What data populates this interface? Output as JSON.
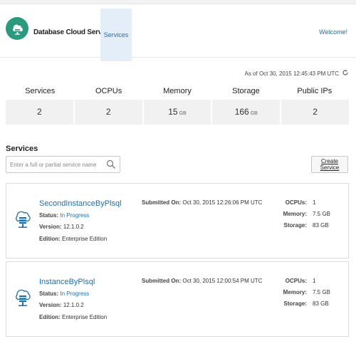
{
  "header": {
    "app_title": "Database Cloud Service",
    "nav_tab": "Services",
    "welcome": "Welcome!"
  },
  "as_of": "As of Oct 30, 2015 12:45:43 PM UTC",
  "summary": {
    "labels": [
      "Services",
      "OCPUs",
      "Memory",
      "Storage",
      "Public IPs"
    ],
    "values": [
      "2",
      "2",
      "15",
      "166",
      "2"
    ],
    "units": [
      "",
      "",
      "GB",
      "GB",
      ""
    ]
  },
  "section_title": "Services",
  "search": {
    "placeholder": "Enter a full or partial service name"
  },
  "create_button": "Create Service",
  "labels": {
    "status": "Status:",
    "version": "Version:",
    "edition": "Edition:",
    "submitted": "Submitted On:",
    "ocpus": "OCPUs:",
    "memory": "Memory:",
    "storage": "Storage:"
  },
  "services": [
    {
      "name": "SecondInstanceByPlsql",
      "status": "In Progress",
      "version": "12.1.0.2",
      "edition": "Enterprise Edition",
      "submitted": "Oct 30, 2015 12:26:06 PM UTC",
      "ocpus": "1",
      "memory": "7.5 GB",
      "storage": "83 GB"
    },
    {
      "name": "InstanceByPlsql",
      "status": "In Progress",
      "version": "12.1.0.2",
      "edition": "Enterprise Edition",
      "submitted": "Oct 30, 2015 12:00:54 PM UTC",
      "ocpus": "1",
      "memory": "7.5 GB",
      "storage": "83 GB"
    }
  ],
  "colors": {
    "brand": "#2c9a7f",
    "link": "#1a6fb0",
    "tab_active_bg": "#e3eef8",
    "summary_bg": "#f1f1f1"
  },
  "icons": {
    "logo": "cloud-database-icon",
    "refresh": "refresh-icon",
    "search": "search-icon",
    "service": "cloud-database-icon"
  }
}
